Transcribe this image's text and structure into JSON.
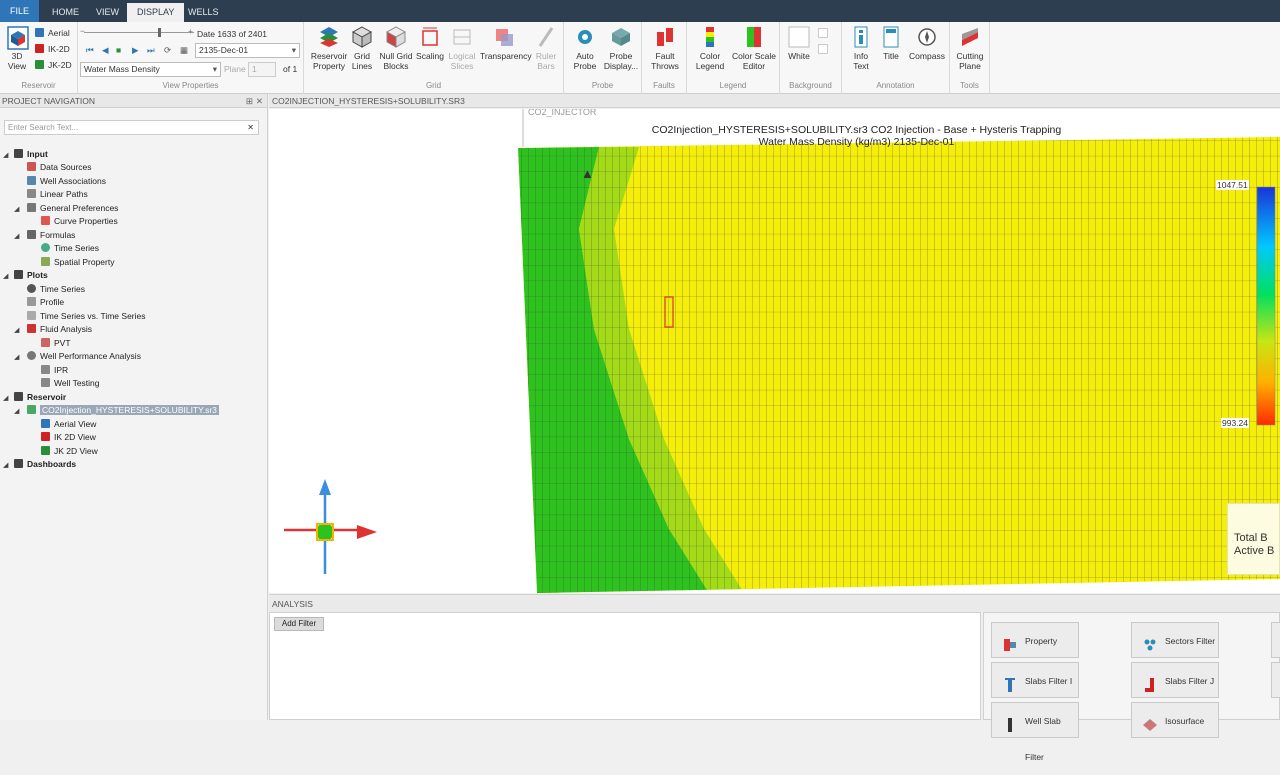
{
  "tabs": {
    "file": "FILE",
    "home": "HOME",
    "view": "VIEW",
    "display": "DISPLAY",
    "wells": "WELLS"
  },
  "ribbon": {
    "reservoir": {
      "view3d": "3D View",
      "aerial": "Aerial",
      "ik2d": "IK-2D",
      "jk2d": "JK-2D",
      "label": "Reservoir"
    },
    "viewprops": {
      "date_label": "Date 1633 of 2401",
      "date_value": "2135-Dec-01",
      "property": "Water Mass Density",
      "plane_label": "Plane",
      "plane_value": "1",
      "plane_of": "of 1",
      "label": "View Properties"
    },
    "grid": {
      "reservoir_property": "Reservoir Property",
      "grid_lines": "Grid Lines",
      "null_grid_blocks": "Null Grid Blocks",
      "scaling": "Scaling",
      "logical_slices": "Logical Slices",
      "transparency": "Transparency",
      "ruler_bars": "Ruler Bars",
      "label": "Grid"
    },
    "probe": {
      "auto_probe": "Auto Probe",
      "probe_display": "Probe Display...",
      "label": "Probe"
    },
    "faults": {
      "fault_throws": "Fault Throws",
      "label": "Faults"
    },
    "legend": {
      "color_legend": "Color Legend",
      "color_scale_editor": "Color Scale Editor",
      "label": "Legend"
    },
    "background": {
      "white": "White",
      "label": "Background"
    },
    "annotation": {
      "info_text": "Info Text",
      "title": "Title",
      "compass": "Compass",
      "label": "Annotation"
    },
    "tools": {
      "cutting_plane": "Cutting Plane",
      "label": "Tools"
    }
  },
  "nav": {
    "title": "PROJECT NAVIGATION",
    "search_placeholder": "Enter Search Text...",
    "items": [
      {
        "label": "Input"
      },
      {
        "label": "Data Sources"
      },
      {
        "label": "Well Associations"
      },
      {
        "label": "Linear Paths"
      },
      {
        "label": "General Preferences"
      },
      {
        "label": "Curve Properties"
      },
      {
        "label": "Formulas"
      },
      {
        "label": "Time Series"
      },
      {
        "label": "Spatial Property"
      },
      {
        "label": "Plots"
      },
      {
        "label": "Time Series"
      },
      {
        "label": "Profile"
      },
      {
        "label": "Time Series vs. Time Series"
      },
      {
        "label": "Fluid Analysis"
      },
      {
        "label": "PVT"
      },
      {
        "label": "Well Performance Analysis"
      },
      {
        "label": "IPR"
      },
      {
        "label": "Well Testing"
      },
      {
        "label": "Reservoir"
      },
      {
        "label": "CO2Injection_HYSTERESIS+SOLUBILITY.sr3"
      },
      {
        "label": "Aerial View"
      },
      {
        "label": "IK 2D View"
      },
      {
        "label": "JK 2D View"
      },
      {
        "label": "Dashboards"
      }
    ]
  },
  "doc_tab": "CO2INJECTION_HYSTERESIS+SOLUBILITY.SR3",
  "view": {
    "well_label": "CO2_INJECTOR",
    "title_line1": "CO2Injection_HYSTERESIS+SOLUBILITY.sr3 CO2 Injection - Base + Hysteris Trapping",
    "title_line2": "Water Mass Density (kg/m3)  2135-Dec-01",
    "legend_max": "1047.51",
    "legend_min": "993.24",
    "info_line1": "Total B",
    "info_line2": "Active B",
    "colors": {
      "green": "#2ec21f",
      "yellow": "#f5ee0a",
      "legend_top": "#1a34d8",
      "legend_bottom": "#ff2a00"
    }
  },
  "analysis": {
    "title": "ANALYSIS",
    "add_filter": "Add Filter"
  },
  "filters": {
    "property": "Property Filter",
    "sectors": "Sectors Filter",
    "slabs_i": "Slabs Filter I",
    "slabs_j": "Slabs Filter J",
    "well_slab": "Well Slab Filter",
    "isosurface": "Isosurface"
  }
}
